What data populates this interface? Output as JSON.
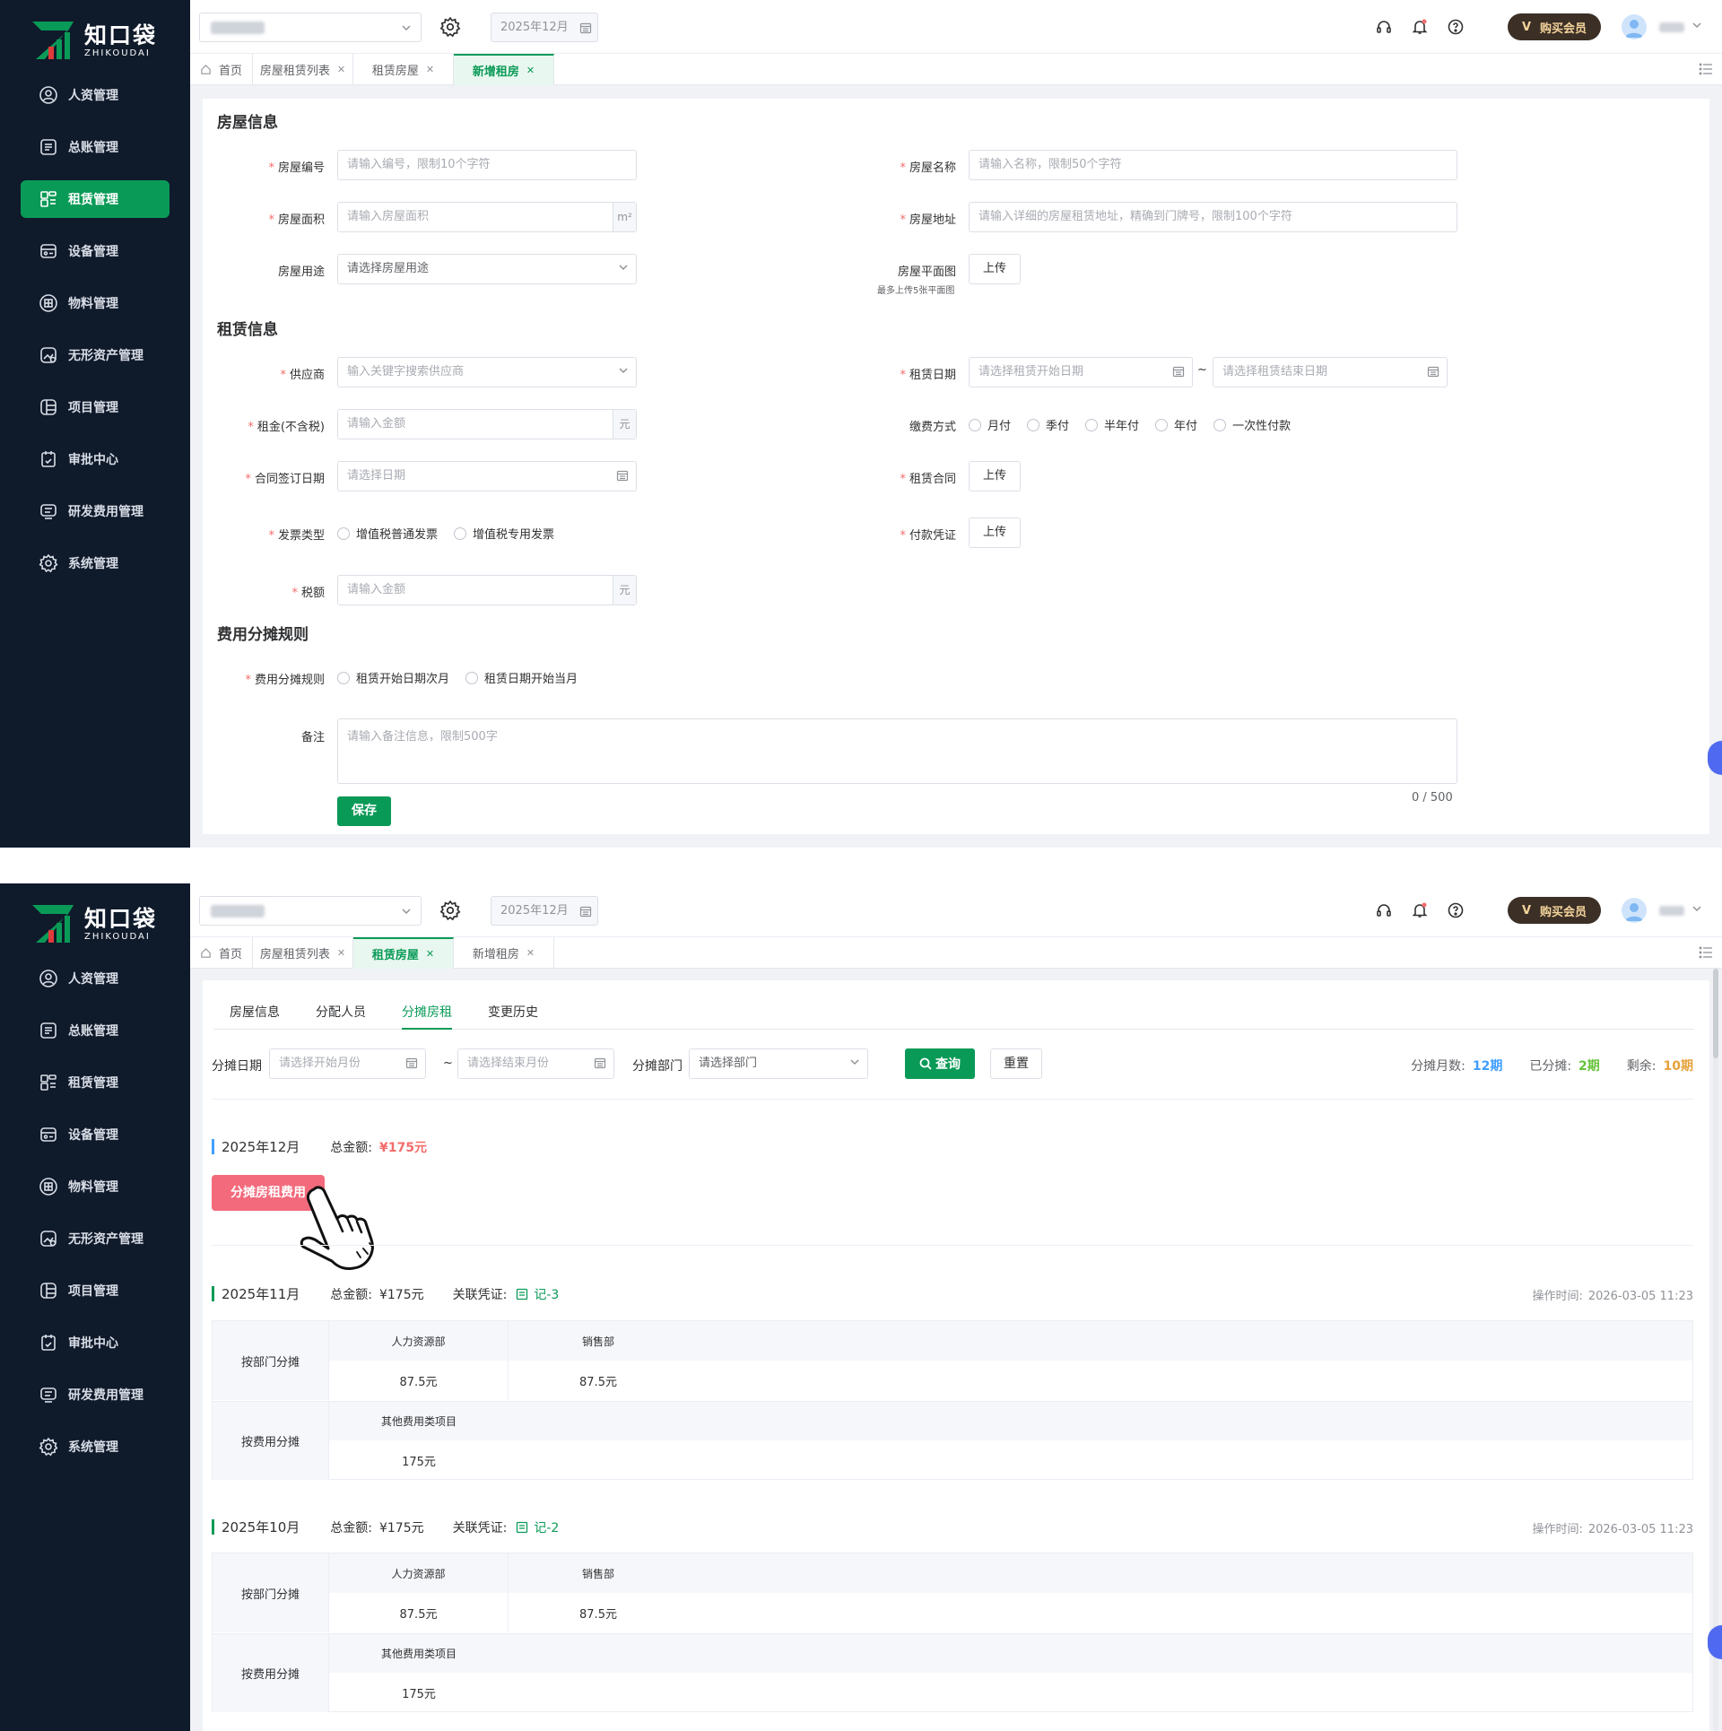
{
  "brand": {
    "name_cn": "知口袋",
    "name_en": "ZHIKOUDAI"
  },
  "colors": {
    "primary": "#0a9a57",
    "danger": "#f56c6c",
    "blue": "#409eff",
    "orange": "#e6a23c",
    "sidebar_bg": "#0f1a2b",
    "vip_bg": "#3b2f26",
    "alloc_btn": "#f26a7c"
  },
  "sidebar": {
    "items": [
      {
        "label": "人资管理",
        "icon": "user-shield-icon"
      },
      {
        "label": "总账管理",
        "icon": "ledger-icon"
      },
      {
        "label": "租赁管理",
        "icon": "lease-icon"
      },
      {
        "label": "设备管理",
        "icon": "device-icon"
      },
      {
        "label": "物料管理",
        "icon": "material-icon"
      },
      {
        "label": "无形资产管理",
        "icon": "intangible-asset-icon"
      },
      {
        "label": "项目管理",
        "icon": "project-icon"
      },
      {
        "label": "审批中心",
        "icon": "approval-icon"
      },
      {
        "label": "研发费用管理",
        "icon": "rd-expense-icon"
      },
      {
        "label": "系统管理",
        "icon": "gear-icon"
      }
    ]
  },
  "header": {
    "period": "2025年12月",
    "vip_label": "购买会员",
    "vip_badge": "V"
  },
  "tabs": [
    {
      "label": "首页"
    },
    {
      "label": "房屋租赁列表"
    },
    {
      "label": "租赁房屋"
    },
    {
      "label": "新增租房"
    }
  ],
  "form": {
    "house_section": "房屋信息",
    "lease_section": "租赁信息",
    "expense_section": "费用分摊规则",
    "house_no": {
      "label": "房屋编号",
      "placeholder": "请输入编号，限制10个字符"
    },
    "house_name": {
      "label": "房屋名称",
      "placeholder": "请输入名称，限制50个字符"
    },
    "house_area": {
      "label": "房屋面积",
      "placeholder": "请输入房屋面积",
      "suffix": "m²"
    },
    "house_addr": {
      "label": "房屋地址",
      "placeholder": "请输入详细的房屋租赁地址，精确到门牌号，限制100个字符"
    },
    "house_use": {
      "label": "房屋用途",
      "placeholder": "请选择房屋用途"
    },
    "floor_plan": {
      "label": "房屋平面图",
      "hint": "最多上传5张平面图",
      "button": "上传"
    },
    "supplier": {
      "label": "供应商",
      "placeholder": "输入关键字搜索供应商"
    },
    "lease_date": {
      "label": "租赁日期",
      "start_placeholder": "请选择租赁开始日期",
      "end_placeholder": "请选择租赁结束日期",
      "sep": "~"
    },
    "rent": {
      "label": "租金(不含税)",
      "placeholder": "请输入金额",
      "suffix": "元"
    },
    "pay_method": {
      "label": "缴费方式",
      "options": [
        "月付",
        "季付",
        "半年付",
        "年付",
        "一次性付款"
      ]
    },
    "sign_date": {
      "label": "合同签订日期",
      "placeholder": "请选择日期"
    },
    "contract": {
      "label": "租赁合同",
      "button": "上传"
    },
    "invoice_type": {
      "label": "发票类型",
      "options": [
        "增值税普通发票",
        "增值税专用发票"
      ]
    },
    "pay_voucher": {
      "label": "付款凭证",
      "button": "上传"
    },
    "tax": {
      "label": "税额",
      "placeholder": "请输入金额",
      "suffix": "元"
    },
    "alloc_rule": {
      "label": "费用分摊规则",
      "options": [
        "租赁开始日期次月",
        "租赁日期开始当月"
      ]
    },
    "remark": {
      "label": "备注",
      "placeholder": "请输入备注信息，限制500字",
      "counter": "0 / 500"
    },
    "save": "保存"
  },
  "detail": {
    "sub_tabs": [
      "房屋信息",
      "分配人员",
      "分摊房租",
      "变更历史"
    ],
    "filter": {
      "date_label": "分摊日期",
      "start_placeholder": "请选择开始月份",
      "sep": "~",
      "end_placeholder": "请选择结束月份",
      "dept_label": "分摊部门",
      "dept_placeholder": "请选择部门",
      "query": "查询",
      "reset": "重置"
    },
    "stats": {
      "total_label": "分摊月数:",
      "total": "12期",
      "done_label": "已分摊:",
      "done": "2期",
      "left_label": "剩余:",
      "left": "10期"
    },
    "amount_label": "总金额:",
    "voucher_label": "关联凭证:",
    "optime_label": "操作时间:",
    "alloc_button": "分摊房租费用",
    "pending": {
      "month": "2025年12月",
      "amount": "¥175元"
    },
    "records": [
      {
        "month": "2025年11月",
        "amount": "¥175元",
        "voucher": "记-3",
        "optime": "2026-03-05 11:23",
        "dept_label": "按部门分摊",
        "depts": [
          {
            "name": "人力资源部",
            "value": "87.5元"
          },
          {
            "name": "销售部",
            "value": "87.5元"
          }
        ],
        "fee_label": "按费用分摊",
        "fees": [
          {
            "name": "其他费用类项目",
            "value": "175元"
          }
        ]
      },
      {
        "month": "2025年10月",
        "amount": "¥175元",
        "voucher": "记-2",
        "optime": "2026-03-05 11:23",
        "dept_label": "按部门分摊",
        "depts": [
          {
            "name": "人力资源部",
            "value": "87.5元"
          },
          {
            "name": "销售部",
            "value": "87.5元"
          }
        ],
        "fee_label": "按费用分摊",
        "fees": [
          {
            "name": "其他费用类项目",
            "value": "175元"
          }
        ]
      }
    ]
  }
}
